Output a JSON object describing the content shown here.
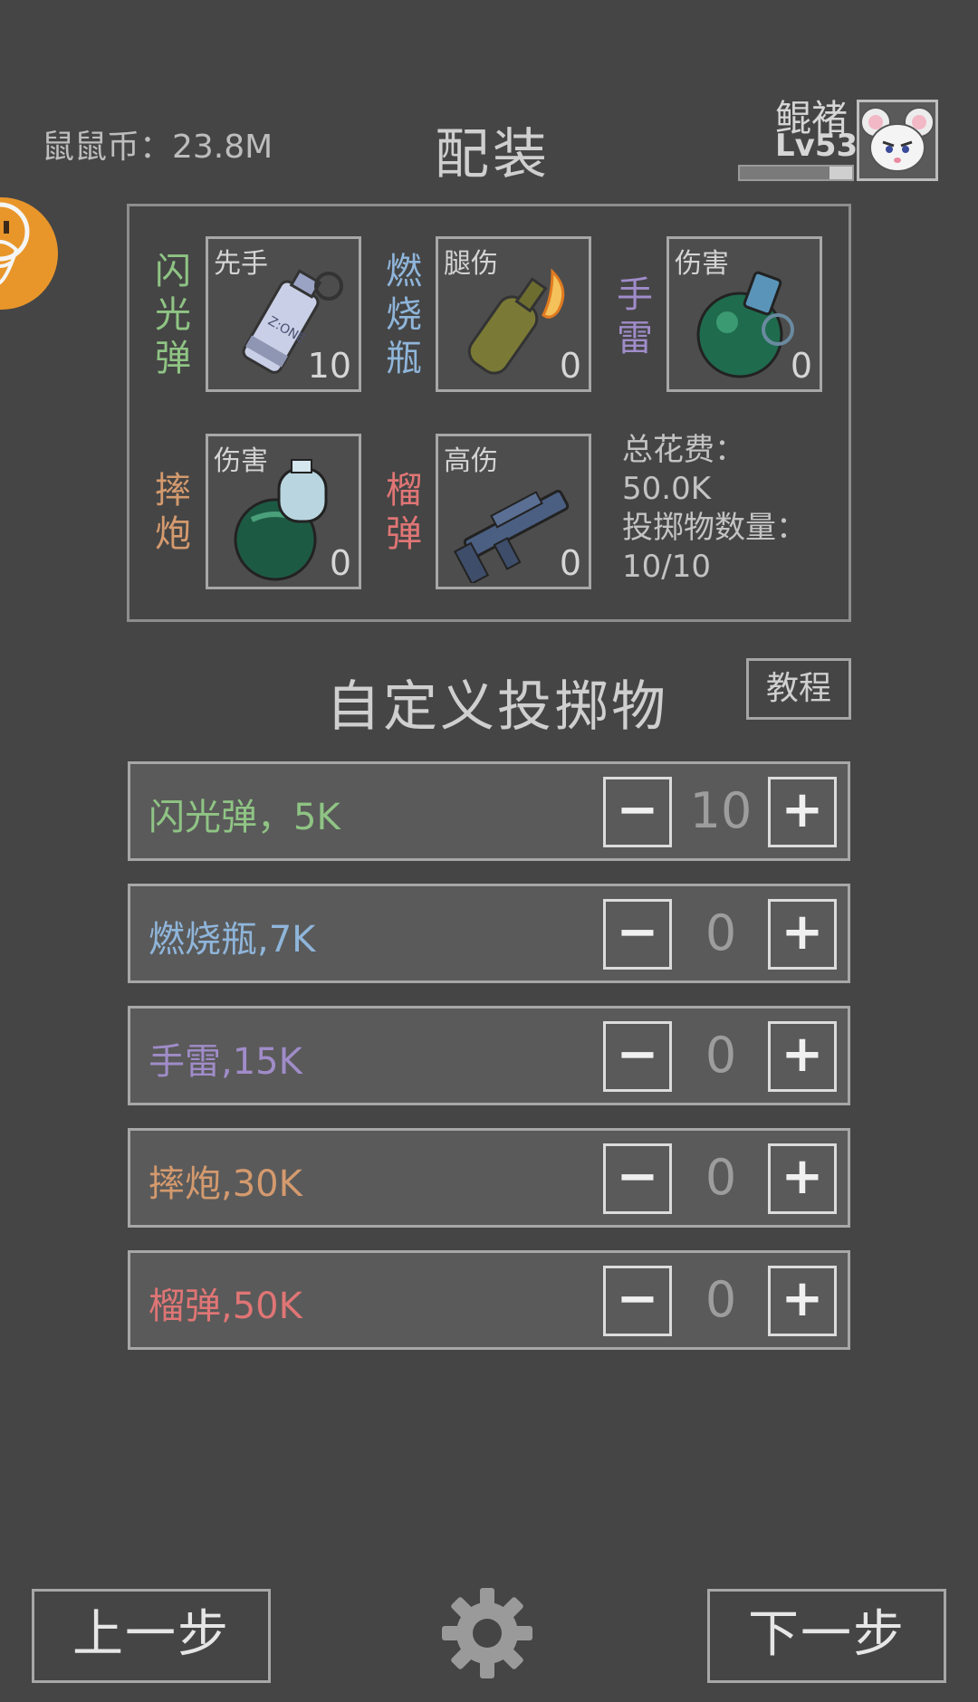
{
  "header": {
    "coins": "鼠鼠币：23.8M",
    "title": "配装",
    "player_name": "鲲褚",
    "player_level": "Lv53",
    "xp_fraction": 0.8
  },
  "loadout": {
    "slots": [
      {
        "name": "闪光弹",
        "tag": "先手",
        "count": "10",
        "color": "#8fc484"
      },
      {
        "name": "燃烧瓶",
        "tag": "腿伤",
        "count": "0",
        "color": "#8fb5da"
      },
      {
        "name": "手雷",
        "tag": "伤害",
        "count": "0",
        "color": "#a08cc9"
      },
      {
        "name": "摔炮",
        "tag": "伤害",
        "count": "0",
        "color": "#d49a6e"
      },
      {
        "name": "榴弹",
        "tag": "高伤",
        "count": "0",
        "color": "#e07575"
      }
    ],
    "summary": {
      "cost_label": "总花费：",
      "cost_value": "50.0K",
      "count_label": "投掷物数量：",
      "count_value": "10/10"
    }
  },
  "custom": {
    "title": "自定义投掷物",
    "tutorial_label": "教程",
    "rows": [
      {
        "label": "闪光弹，5K",
        "value": "10",
        "color": "#8fc484"
      },
      {
        "label": "燃烧瓶,7K",
        "value": "0",
        "color": "#8fb5da"
      },
      {
        "label": "手雷,15K",
        "value": "0",
        "color": "#a08cc9"
      },
      {
        "label": "摔炮,30K",
        "value": "0",
        "color": "#d49a6e"
      },
      {
        "label": "榴弹,50K",
        "value": "0",
        "color": "#e07575"
      }
    ],
    "minus_label": "−",
    "plus_label": "+"
  },
  "nav": {
    "prev_label": "上一步",
    "next_label": "下一步"
  },
  "icons": [
    "avatar-mouse-icon",
    "flashbang-icon",
    "molotov-icon",
    "grenade-icon",
    "popper-icon",
    "grenade-launcher-icon",
    "gear-icon",
    "side-badge-icon"
  ]
}
